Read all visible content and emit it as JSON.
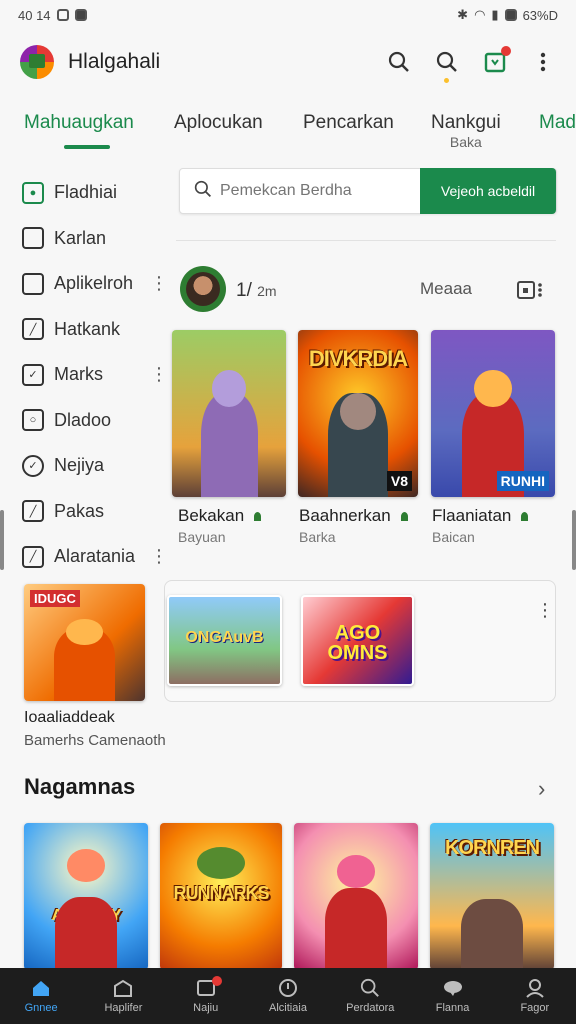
{
  "status": {
    "time": "40 14",
    "battery": "63%D"
  },
  "app": {
    "title": "Hlalgahali"
  },
  "tabs": [
    {
      "label": "Mahuaugkan"
    },
    {
      "label": "Aplocukan"
    },
    {
      "label": "Pencarkan"
    },
    {
      "label": "Nankgui",
      "sub": "Baka"
    },
    {
      "label": "Mad"
    }
  ],
  "sidebar": {
    "items": [
      {
        "label": "Fladhiai",
        "icon": "store-icon"
      },
      {
        "label": "Karlan",
        "icon": "card-icon"
      },
      {
        "label": "Aplikelroh",
        "icon": "folder-icon"
      },
      {
        "label": "Hatkank",
        "icon": "edit-icon"
      },
      {
        "label": "Marks",
        "icon": "chat-icon"
      },
      {
        "label": "Dladoo",
        "icon": "camera-icon"
      },
      {
        "label": "Nejiya",
        "icon": "check-circle-icon"
      },
      {
        "label": "Pakas",
        "icon": "edit-icon"
      },
      {
        "label": "Alaratania",
        "icon": "edit-icon"
      }
    ]
  },
  "search": {
    "placeholder": "Pemekcan Berdha",
    "button": "Vejeoh acbeldil"
  },
  "featured": {
    "label": "1/",
    "label_small": "2m",
    "more": "Meaaa",
    "games": [
      {
        "title": "Bekakan",
        "sub": "Bayuan",
        "tag": "",
        "banner": ""
      },
      {
        "title": "Baahnerkan",
        "sub": "Barka",
        "tag": "V8",
        "banner": "DIVKRDIA"
      },
      {
        "title": "Flaaniatan",
        "sub": "Baican",
        "tag": "RUNHI",
        "banner": ""
      }
    ]
  },
  "promo": {
    "label": "Ioaaliaddeak",
    "sub": "Bamerhs Camenaoth",
    "card_banner": "IDUGC",
    "mini_games": [
      "ONGAuvB",
      "AGO OMNS"
    ]
  },
  "section": {
    "title": "Nagamnas",
    "cards": [
      {
        "banner": "AKIIONAY"
      },
      {
        "banner": "RUNNARKS"
      },
      {
        "banner": ""
      },
      {
        "banner": "KORNREN"
      }
    ]
  },
  "nav": [
    {
      "label": "Gnnee",
      "icon": "home-icon"
    },
    {
      "label": "Haplifer",
      "icon": "bag-icon"
    },
    {
      "label": "Najiu",
      "icon": "inbox-icon"
    },
    {
      "label": "Alcitiaia",
      "icon": "compass-icon"
    },
    {
      "label": "Perdatora",
      "icon": "search-icon"
    },
    {
      "label": "Flanna",
      "icon": "chat-icon"
    },
    {
      "label": "Fagor",
      "icon": "profile-icon"
    }
  ],
  "colors": {
    "accent": "#1b8a4c",
    "nav_bg": "#1d1d1d",
    "nav_active": "#42a5f5"
  }
}
